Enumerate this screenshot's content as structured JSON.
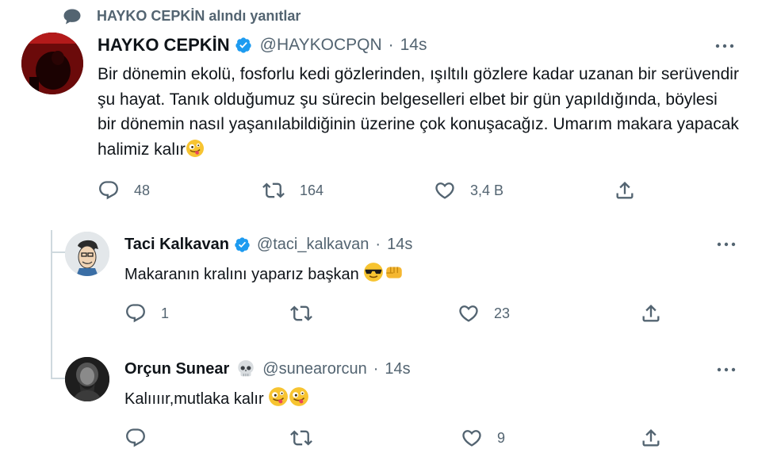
{
  "reply_context": {
    "text": "HAYKO CEPKİN alındı yanıtlar",
    "icon": "speech-bubble-icon"
  },
  "tweets": [
    {
      "name": "HAYKO CEPKİN",
      "verified": true,
      "handle": "@HAYKOCPQN",
      "separator": "·",
      "time": "14s",
      "text": "Bir dönemin ekolü, fosforlu kedi gözlerinden, ışıltılı gözlere kadar uzanan bir serüvendir şu hayat. Tanık olduğumuz şu sürecin belgeselleri elbet bir gün yapıldığında, böylesi bir dönemin nasıl yaşanılabildiğinin üzerine çok konuşacağız. Umarım makara yapacak halimiz kalır",
      "emojis": [
        "zany-face"
      ],
      "replies": "48",
      "retweets": "164",
      "likes": "3,4 B"
    },
    {
      "name": "Taci Kalkavan",
      "verified": true,
      "handle": "@taci_kalkavan",
      "separator": "·",
      "time": "14s",
      "text": "Makaranın kralını yaparız başkan",
      "emojis": [
        "sunglasses-face",
        "oncoming-fist"
      ],
      "replies": "1",
      "retweets": "",
      "likes": "23"
    },
    {
      "name": "Orçun Sunear",
      "verified": false,
      "name_emoji": "skull",
      "handle": "@sunearorcun",
      "separator": "·",
      "time": "14s",
      "text": "Kalıııır,mutlaka kalır",
      "emojis": [
        "zany-face",
        "zany-face"
      ],
      "replies": "",
      "retweets": "",
      "likes": "9"
    }
  ],
  "colors": {
    "text_primary": "#0f1419",
    "text_secondary": "#536471",
    "verified_blue": "#1d9bf0",
    "thread_line": "#cfd9de"
  }
}
